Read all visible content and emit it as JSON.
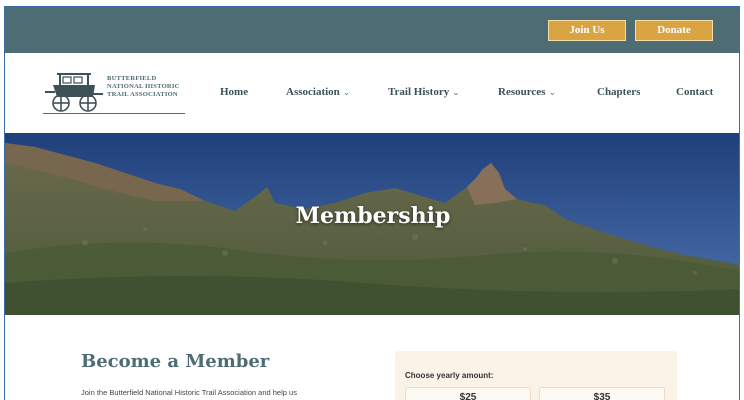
{
  "topbar": {
    "join_label": "Join Us",
    "donate_label": "Donate",
    "background": "#4e6c73",
    "button_color": "#d9a441"
  },
  "logo": {
    "line1": "BUTTERFIELD",
    "line2": "NATIONAL HISTORIC",
    "line3": "TRAIL ASSOCIATION"
  },
  "nav": {
    "items": [
      {
        "label": "Home",
        "has_dropdown": false
      },
      {
        "label": "Association",
        "has_dropdown": true
      },
      {
        "label": "Trail History",
        "has_dropdown": true
      },
      {
        "label": "Resources",
        "has_dropdown": true
      },
      {
        "label": "Chapters",
        "has_dropdown": false
      },
      {
        "label": "Contact",
        "has_dropdown": false
      }
    ],
    "chevron": "⌄"
  },
  "hero": {
    "title": "Membership"
  },
  "main": {
    "heading": "Become a Member",
    "intro": "Join the Butterfield National Historic Trail Association and help us",
    "amount_panel": {
      "label": "Choose yearly amount:",
      "amounts": [
        "$25",
        "$35"
      ]
    }
  }
}
